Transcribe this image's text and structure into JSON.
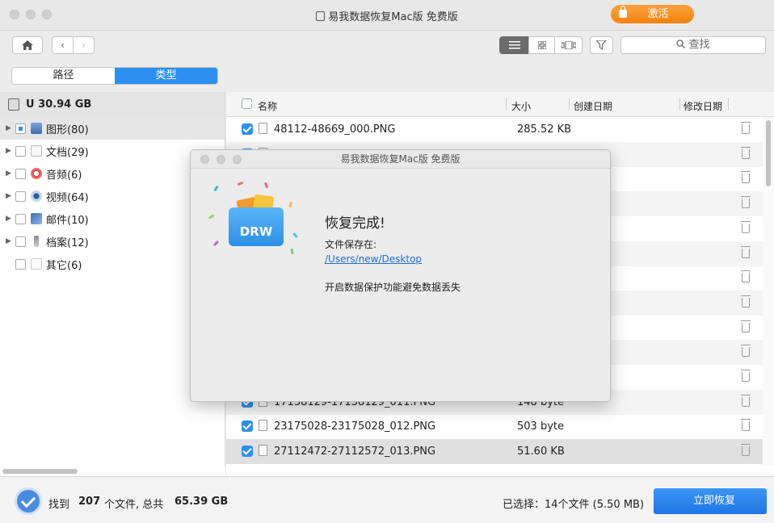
{
  "app": {
    "title": "易我数据恢复Mac版 免费版",
    "activate_label": "激活"
  },
  "toolbar": {
    "search_placeholder": "查找"
  },
  "tabs": [
    {
      "label": "路径"
    },
    {
      "label": "类型"
    }
  ],
  "sidebar": {
    "drive_label": "U 30.94 GB",
    "items": [
      {
        "label": "图形(80)",
        "icon": "image-icon"
      },
      {
        "label": "文档(29)",
        "icon": "document-icon"
      },
      {
        "label": "音频(6)",
        "icon": "music-icon"
      },
      {
        "label": "视频(64)",
        "icon": "video-icon"
      },
      {
        "label": "邮件(10)",
        "icon": "mail-icon"
      },
      {
        "label": "档案(12)",
        "icon": "archive-icon"
      },
      {
        "label": "其它(6)",
        "icon": "other-file-icon"
      }
    ]
  },
  "table": {
    "headers": {
      "name": "名称",
      "size": "大小",
      "created": "创建日期",
      "modified": "修改日期"
    },
    "rows": [
      {
        "name": "48112-48669_000.PNG",
        "size": "285.52 KB"
      },
      {
        "name": "",
        "size": ""
      },
      {
        "name": "",
        "size": ""
      },
      {
        "name": "",
        "size": ""
      },
      {
        "name": "",
        "size": ""
      },
      {
        "name": "",
        "size": ""
      },
      {
        "name": "",
        "size": ""
      },
      {
        "name": "",
        "size": ""
      },
      {
        "name": "",
        "size": ""
      },
      {
        "name": "",
        "size": ""
      },
      {
        "name": "",
        "size": ""
      },
      {
        "name": "17138129-17138129_011.PNG",
        "size": "148 byte"
      },
      {
        "name": "23175028-23175028_012.PNG",
        "size": "503 byte"
      },
      {
        "name": "27112472-27112572_013.PNG",
        "size": "51.60 KB"
      }
    ]
  },
  "footer": {
    "found_prefix": "找到",
    "found_count": "207",
    "found_mid": "个文件, 总共",
    "found_total": "65.39 GB",
    "selected_text": "已选择：14个文件 (5.50 MB)",
    "recover_label": "立即恢复"
  },
  "dialog": {
    "title": "易我数据恢复Mac版 免费版",
    "heading": "恢复完成!",
    "saved_to_label": "文件保存在:",
    "path_link": "/Users/new/Desktop",
    "protect_text": "开启数据保护功能避免数据丢失",
    "logo_text": "DRW"
  },
  "colors": {
    "accent": "#2d8ff0",
    "activate_orange": "#f6820c",
    "link": "#1f6fd4"
  }
}
